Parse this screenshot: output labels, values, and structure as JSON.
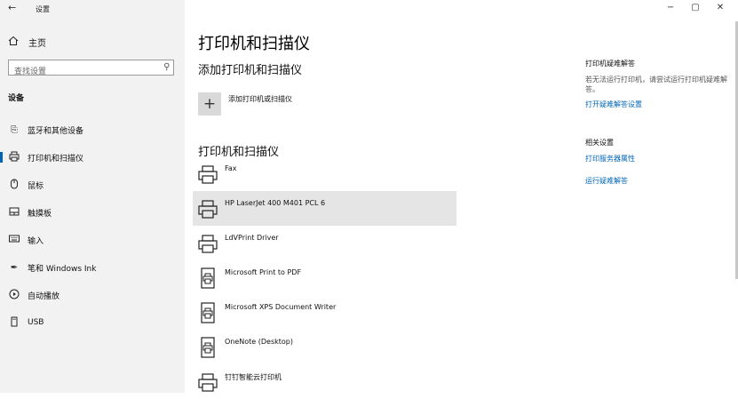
{
  "window": {
    "title": "设置",
    "back_glyph": "←",
    "controls": {
      "minimize": "−",
      "maximize": "▢",
      "close": "✕"
    }
  },
  "sidebar": {
    "home": {
      "label": "主页",
      "icon": "home-icon"
    },
    "search": {
      "placeholder": "查找设置",
      "value": "",
      "icon": "search-icon"
    },
    "section": "设备",
    "items": [
      {
        "label": "蓝牙和其他设备",
        "icon": "bluetooth-devices-icon",
        "glyph": "⎘",
        "active": false
      },
      {
        "label": "打印机和扫描仪",
        "icon": "printer-icon",
        "glyph": "⎙",
        "active": true
      },
      {
        "label": "鼠标",
        "icon": "mouse-icon",
        "glyph": "◯",
        "active": false
      },
      {
        "label": "触摸板",
        "icon": "touchpad-icon",
        "glyph": "▭",
        "active": false
      },
      {
        "label": "输入",
        "icon": "keyboard-icon",
        "glyph": "⌨",
        "active": false
      },
      {
        "label": "笔和 Windows Ink",
        "icon": "pen-icon",
        "glyph": "✒",
        "active": false
      },
      {
        "label": "自动播放",
        "icon": "autoplay-icon",
        "glyph": "▷",
        "active": false
      },
      {
        "label": "USB",
        "icon": "usb-icon",
        "glyph": "▯",
        "active": false
      }
    ]
  },
  "main": {
    "page_title": "打印机和扫描仪",
    "add_heading": "添加打印机和扫描仪",
    "add_button": {
      "label": "添加打印机或扫描仪",
      "glyph": "+"
    },
    "printers_heading": "打印机和扫描仪",
    "printers": [
      {
        "name": "Fax",
        "icon": "printer-icon",
        "selected": false
      },
      {
        "name": "HP LaserJet 400 M401 PCL 6",
        "icon": "printer-icon",
        "selected": true
      },
      {
        "name": "LdVPrint Driver",
        "icon": "printer-icon",
        "selected": false
      },
      {
        "name": "Microsoft Print to PDF",
        "icon": "document-printer-icon",
        "selected": false
      },
      {
        "name": "Microsoft XPS Document Writer",
        "icon": "document-printer-icon",
        "selected": false
      },
      {
        "name": "OneNote (Desktop)",
        "icon": "document-printer-icon",
        "selected": false
      },
      {
        "name": "钉钉智能云打印机",
        "icon": "printer-icon",
        "selected": false
      }
    ]
  },
  "right_panel": {
    "troubleshoot_heading": "打印机疑难解答",
    "troubleshoot_text": "若无法运行打印机，请尝试运行打印机疑难解答。",
    "troubleshoot_link": "打开疑难解答设置",
    "related_heading": "相关设置",
    "related_links": [
      "打印服务器属性",
      "运行疑难解答"
    ]
  },
  "colors": {
    "accent": "#0066b4",
    "sidebar_bg": "#f2f2f2",
    "selected_bg": "#e5e5e5"
  }
}
